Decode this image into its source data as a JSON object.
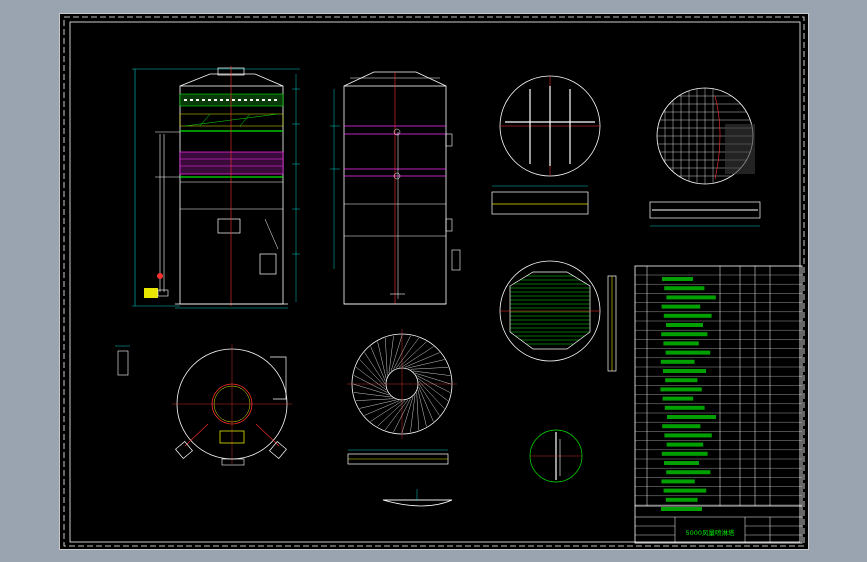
{
  "window": {
    "background": "#9aa4b1",
    "canvas_background": "#000000"
  },
  "drawing": {
    "title_block_name": "5000风量喷淋塔",
    "colors": {
      "frame": "#ffffff",
      "frame_inner": "#ffffff",
      "outline": "#ffffff",
      "dimension": "#00c8c8",
      "green": "#00e600",
      "red": "#ff3030",
      "magenta": "#ff30ff",
      "yellow": "#e6e600",
      "cyan": "#00ffff"
    }
  }
}
